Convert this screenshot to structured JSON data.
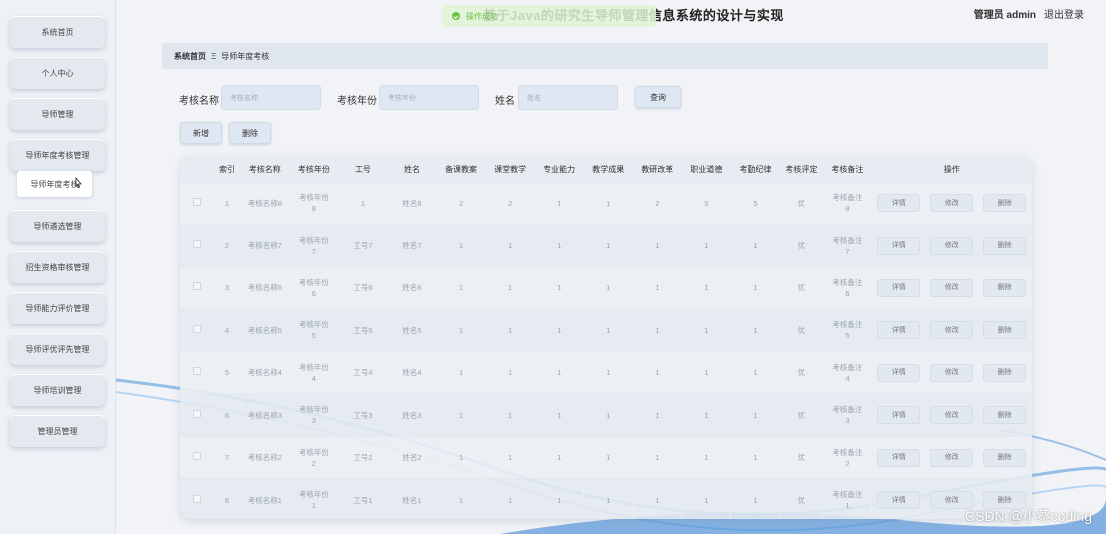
{
  "header": {
    "title": "基于Java的研究生导师管理信息系统的设计与实现",
    "user": "管理员 admin",
    "logout": "退出登录"
  },
  "toast": {
    "text": "操作成功"
  },
  "sidebar": {
    "items": [
      {
        "label": "系统首页"
      },
      {
        "label": "个人中心"
      },
      {
        "label": "导师管理"
      },
      {
        "label": "导师年度考核管理"
      },
      {
        "label": "导师遴选管理"
      },
      {
        "label": "招生资格审核管理"
      },
      {
        "label": "导师能力评价管理"
      },
      {
        "label": "导师评优评先管理"
      },
      {
        "label": "导师培训管理"
      },
      {
        "label": "管理员管理"
      }
    ],
    "submenu": {
      "label": "导师年度考核"
    }
  },
  "breadcrumb": {
    "home": "系统首页",
    "separator": "Ξ",
    "current": "导师年度考核"
  },
  "search": {
    "fields": [
      {
        "label": "考核名称",
        "placeholder": "考核名称"
      },
      {
        "label": "考核年份",
        "placeholder": "考核年份"
      },
      {
        "label": "姓名",
        "placeholder": "姓名"
      }
    ],
    "query_label": "查询"
  },
  "actions": {
    "add_label": "新增",
    "delete_label": "删除"
  },
  "table": {
    "headers": [
      "",
      "索引",
      "考核名称",
      "考核年份",
      "工号",
      "姓名",
      "备课教案",
      "课堂教学",
      "专业能力",
      "教学成果",
      "教研改革",
      "职业道德",
      "考勤纪律",
      "考核评定",
      "考核备注",
      "操作"
    ],
    "row_actions": [
      "详情",
      "修改",
      "删除"
    ],
    "rows": [
      [
        "1",
        "考核名称8",
        "考核年份8",
        "1",
        "姓名8",
        "2",
        "2",
        "1",
        "1",
        "2",
        "5",
        "5",
        "优",
        "考核备注8"
      ],
      [
        "2",
        "考核名称7",
        "考核年份7",
        "工号7",
        "姓名7",
        "1",
        "1",
        "1",
        "1",
        "1",
        "1",
        "1",
        "优",
        "考核备注7"
      ],
      [
        "3",
        "考核名称6",
        "考核年份6",
        "工号6",
        "姓名6",
        "1",
        "1",
        "1",
        "1",
        "1",
        "1",
        "1",
        "优",
        "考核备注6"
      ],
      [
        "4",
        "考核名称5",
        "考核年份5",
        "工号5",
        "姓名5",
        "1",
        "1",
        "1",
        "1",
        "1",
        "1",
        "1",
        "优",
        "考核备注5"
      ],
      [
        "5",
        "考核名称4",
        "考核年份4",
        "工号4",
        "姓名4",
        "1",
        "1",
        "1",
        "1",
        "1",
        "1",
        "1",
        "优",
        "考核备注4"
      ],
      [
        "6",
        "考核名称3",
        "考核年份3",
        "工号3",
        "姓名3",
        "1",
        "1",
        "1",
        "1",
        "1",
        "1",
        "1",
        "优",
        "考核备注3"
      ],
      [
        "7",
        "考核名称2",
        "考核年份2",
        "工号2",
        "姓名2",
        "1",
        "1",
        "1",
        "1",
        "1",
        "1",
        "1",
        "优",
        "考核备注2"
      ],
      [
        "8",
        "考核名称1",
        "考核年份1",
        "工号1",
        "姓名1",
        "1",
        "1",
        "1",
        "1",
        "1",
        "1",
        "1",
        "优",
        "考核备注1"
      ]
    ]
  },
  "watermark": "CSDN @小蔡coding",
  "colors": {
    "toast_green": "#67c23a",
    "wave_blue": "#4a90d9"
  }
}
